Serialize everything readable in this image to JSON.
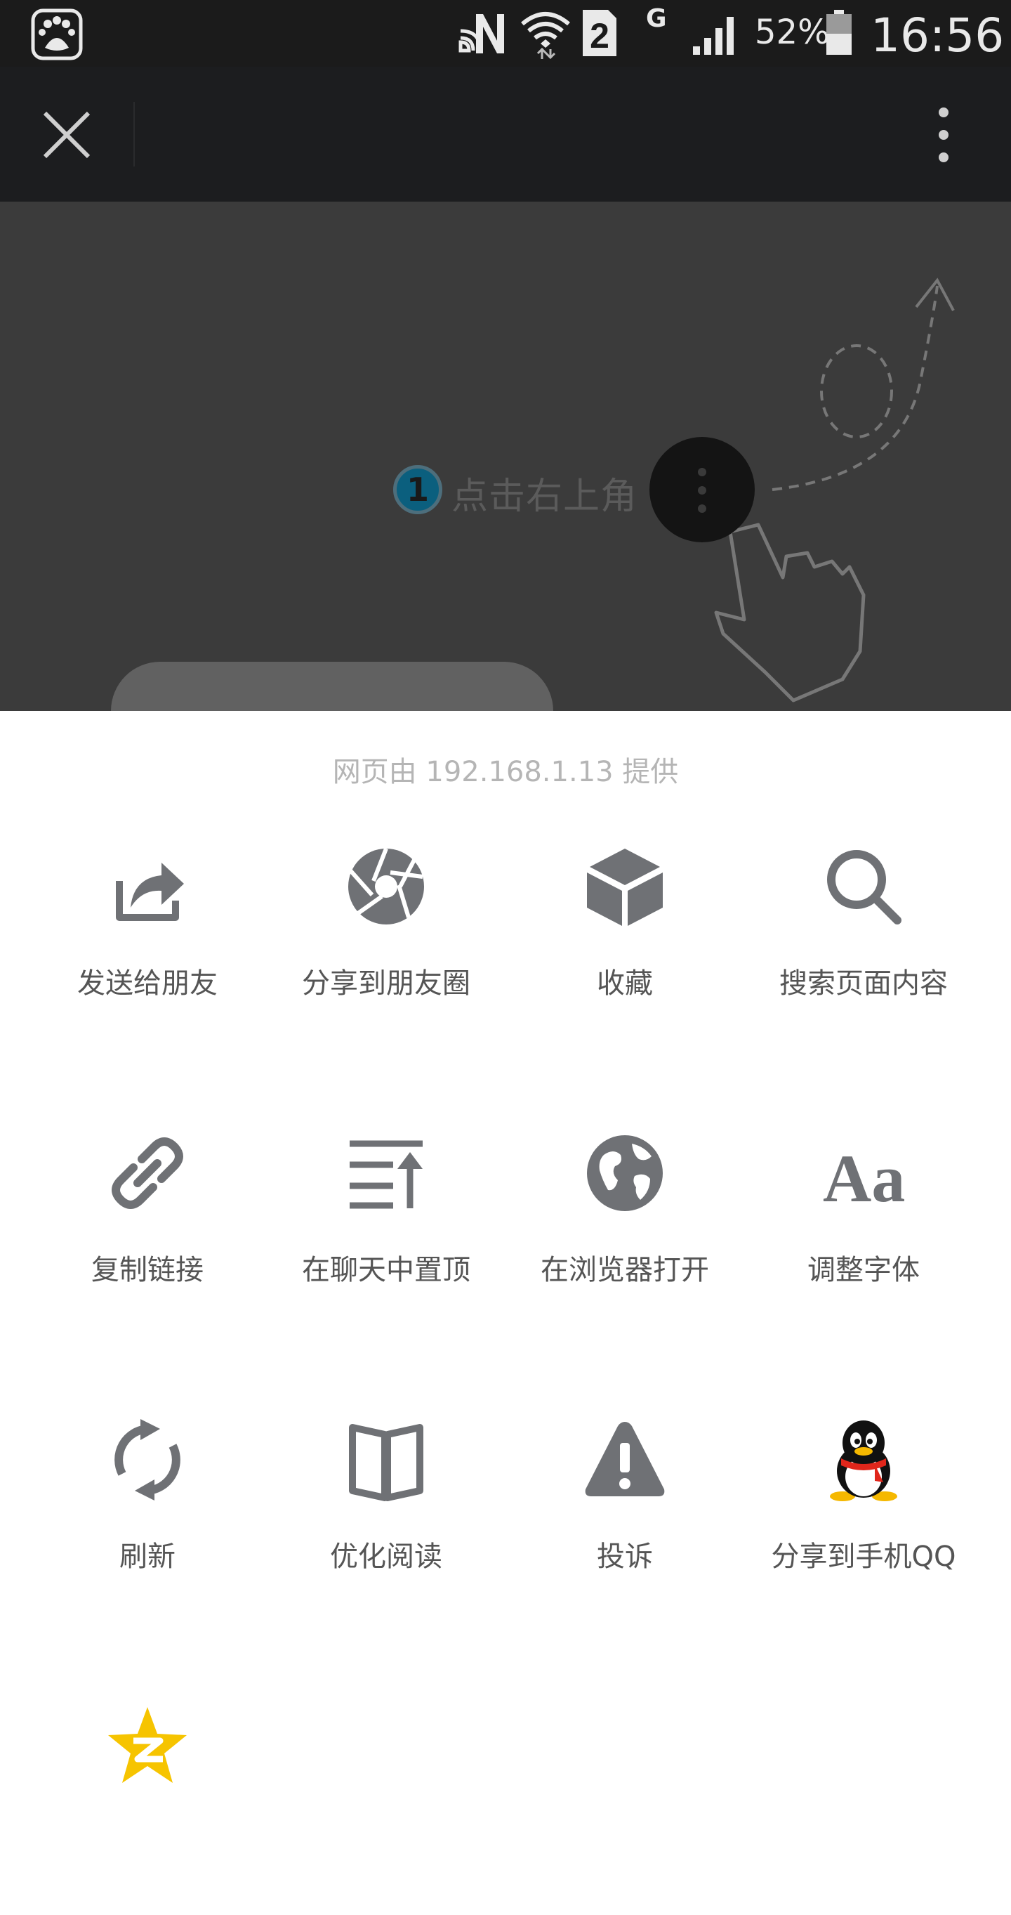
{
  "status_bar": {
    "battery": "52%",
    "time": "16:56",
    "sim_slot": "2",
    "network_type": "G",
    "icons": [
      "baidu-paw-icon",
      "nfc-icon",
      "wifi-icon",
      "sim-2-icon",
      "signal-icon",
      "battery-icon"
    ]
  },
  "toolbar": {
    "icons": [
      "close-icon",
      "more-vertical-icon"
    ]
  },
  "guide": {
    "step_number": "1",
    "step_text": "点击右上角"
  },
  "sheet": {
    "provider_text": "网页由 192.168.1.13 提供",
    "items": [
      {
        "label": "发送给朋友",
        "icon": "send-to-friend-icon"
      },
      {
        "label": "分享到朋友圈",
        "icon": "moments-shutter-icon"
      },
      {
        "label": "收藏",
        "icon": "cube-favorite-icon"
      },
      {
        "label": "搜索页面内容",
        "icon": "search-icon"
      },
      {
        "label": "复制链接",
        "icon": "link-icon"
      },
      {
        "label": "在聊天中置顶",
        "icon": "pin-to-top-icon"
      },
      {
        "label": "在浏览器打开",
        "icon": "globe-icon"
      },
      {
        "label": "调整字体",
        "icon": "font-size-icon"
      },
      {
        "label": "刷新",
        "icon": "refresh-icon"
      },
      {
        "label": "优化阅读",
        "icon": "book-open-icon"
      },
      {
        "label": "投诉",
        "icon": "warning-icon"
      },
      {
        "label": "分享到手机QQ",
        "icon": "qq-penguin-icon"
      },
      {
        "label": "",
        "icon": "qzone-star-icon"
      }
    ]
  },
  "colors": {
    "status_bar_bg": "#1b1b1b",
    "toolbar_bg": "#1c1d1f",
    "overlay_bg": "#3b3b3b",
    "icon_gray": "#6f7175",
    "label_gray": "#555555",
    "provider_gray": "#b5b5b5",
    "qzone_yellow": "#f6c400"
  }
}
